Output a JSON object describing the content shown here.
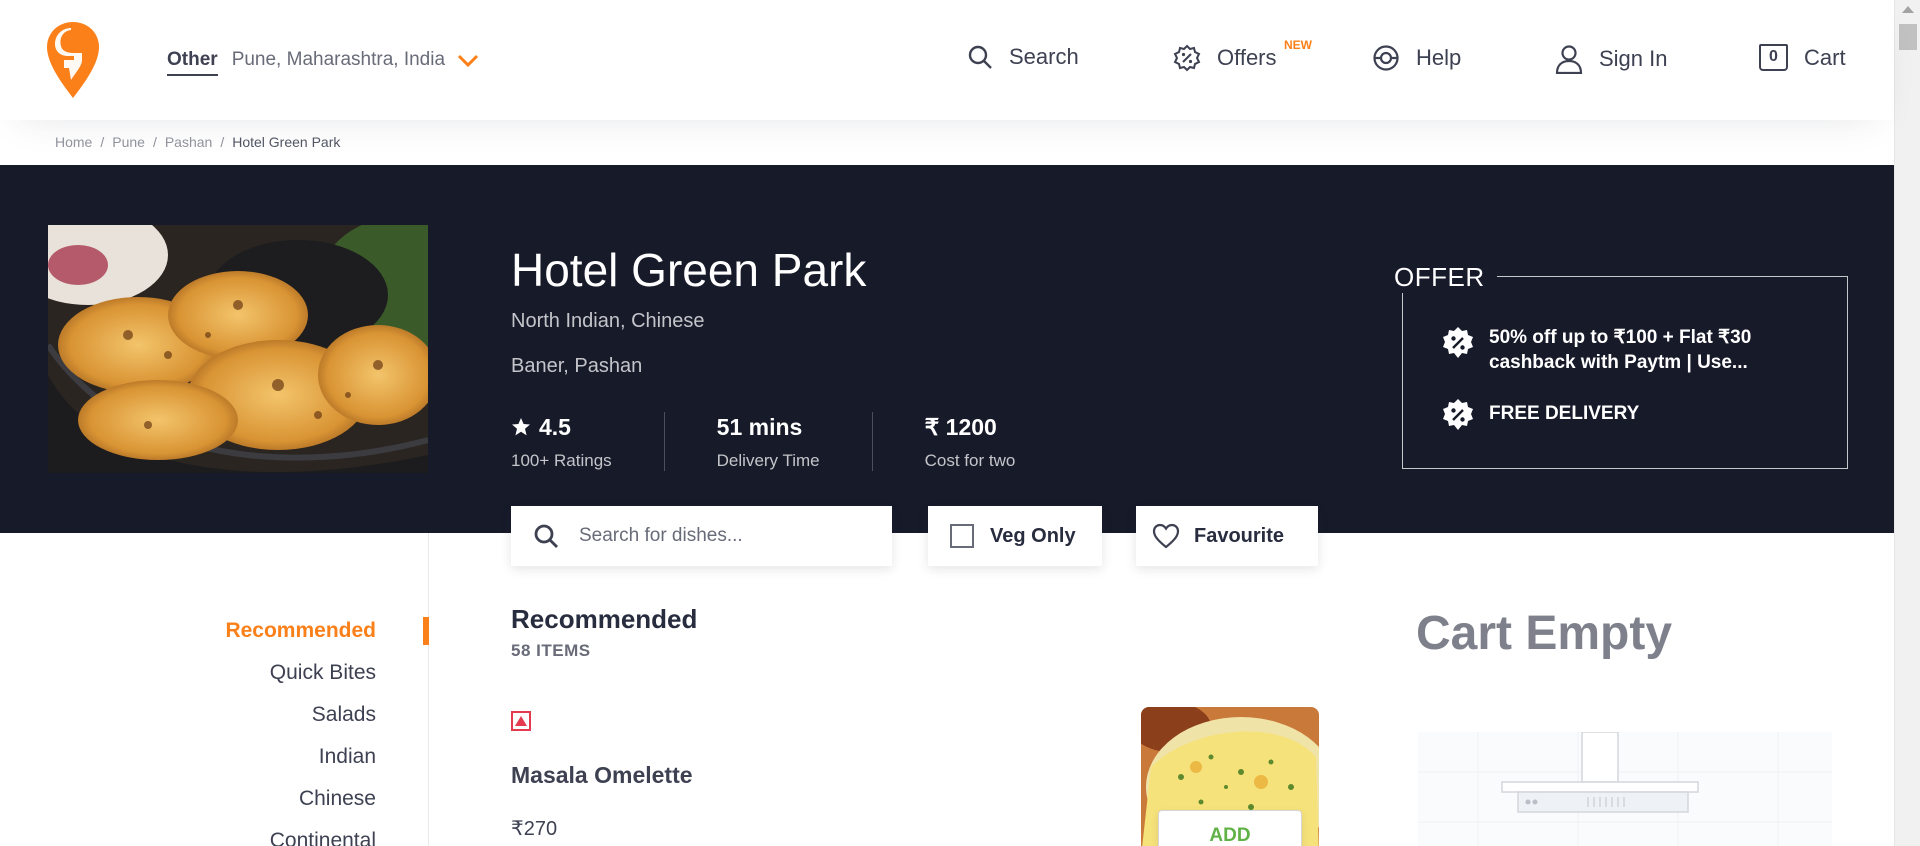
{
  "header": {
    "location_label": "Other",
    "location_address": "Pune, Maharashtra, India",
    "nav": {
      "search": "Search",
      "offers": "Offers",
      "offers_badge": "NEW",
      "help": "Help",
      "sign_in": "Sign In",
      "cart": "Cart",
      "cart_count": "0"
    }
  },
  "breadcrumb": {
    "home": "Home",
    "city": "Pune",
    "area": "Pashan",
    "current": "Hotel Green Park",
    "separator": "/"
  },
  "restaurant": {
    "name": "Hotel Green Park",
    "cuisines": "North Indian, Chinese",
    "locality": "Baner, Pashan",
    "rating": "4.5",
    "rating_label": "100+ Ratings",
    "delivery_time": "51 mins",
    "delivery_label": "Delivery Time",
    "cost": "₹ 1200",
    "cost_label": "Cost for two"
  },
  "offer": {
    "title": "OFFER",
    "line1a": "50% off up to ₹100 + Flat ₹30",
    "line1b": "cashback with Paytm | Use...",
    "line2": "FREE DELIVERY"
  },
  "controls": {
    "search_placeholder": "Search for dishes...",
    "veg_only": "Veg Only",
    "favourite": "Favourite"
  },
  "menu": {
    "items": [
      "Recommended",
      "Quick Bites",
      "Salads",
      "Indian",
      "Chinese",
      "Continental"
    ],
    "active": "Recommended"
  },
  "section": {
    "title": "Recommended",
    "count": "58 ITEMS",
    "item": {
      "name": "Masala Omelette",
      "price": "₹270",
      "add": "ADD",
      "type": "non-veg"
    }
  },
  "cart": {
    "title": "Cart Empty"
  },
  "colors": {
    "accent": "#fc8019",
    "hero_bg": "#171a29",
    "add_green": "#60b246",
    "nonveg_red": "#e43b4f"
  }
}
